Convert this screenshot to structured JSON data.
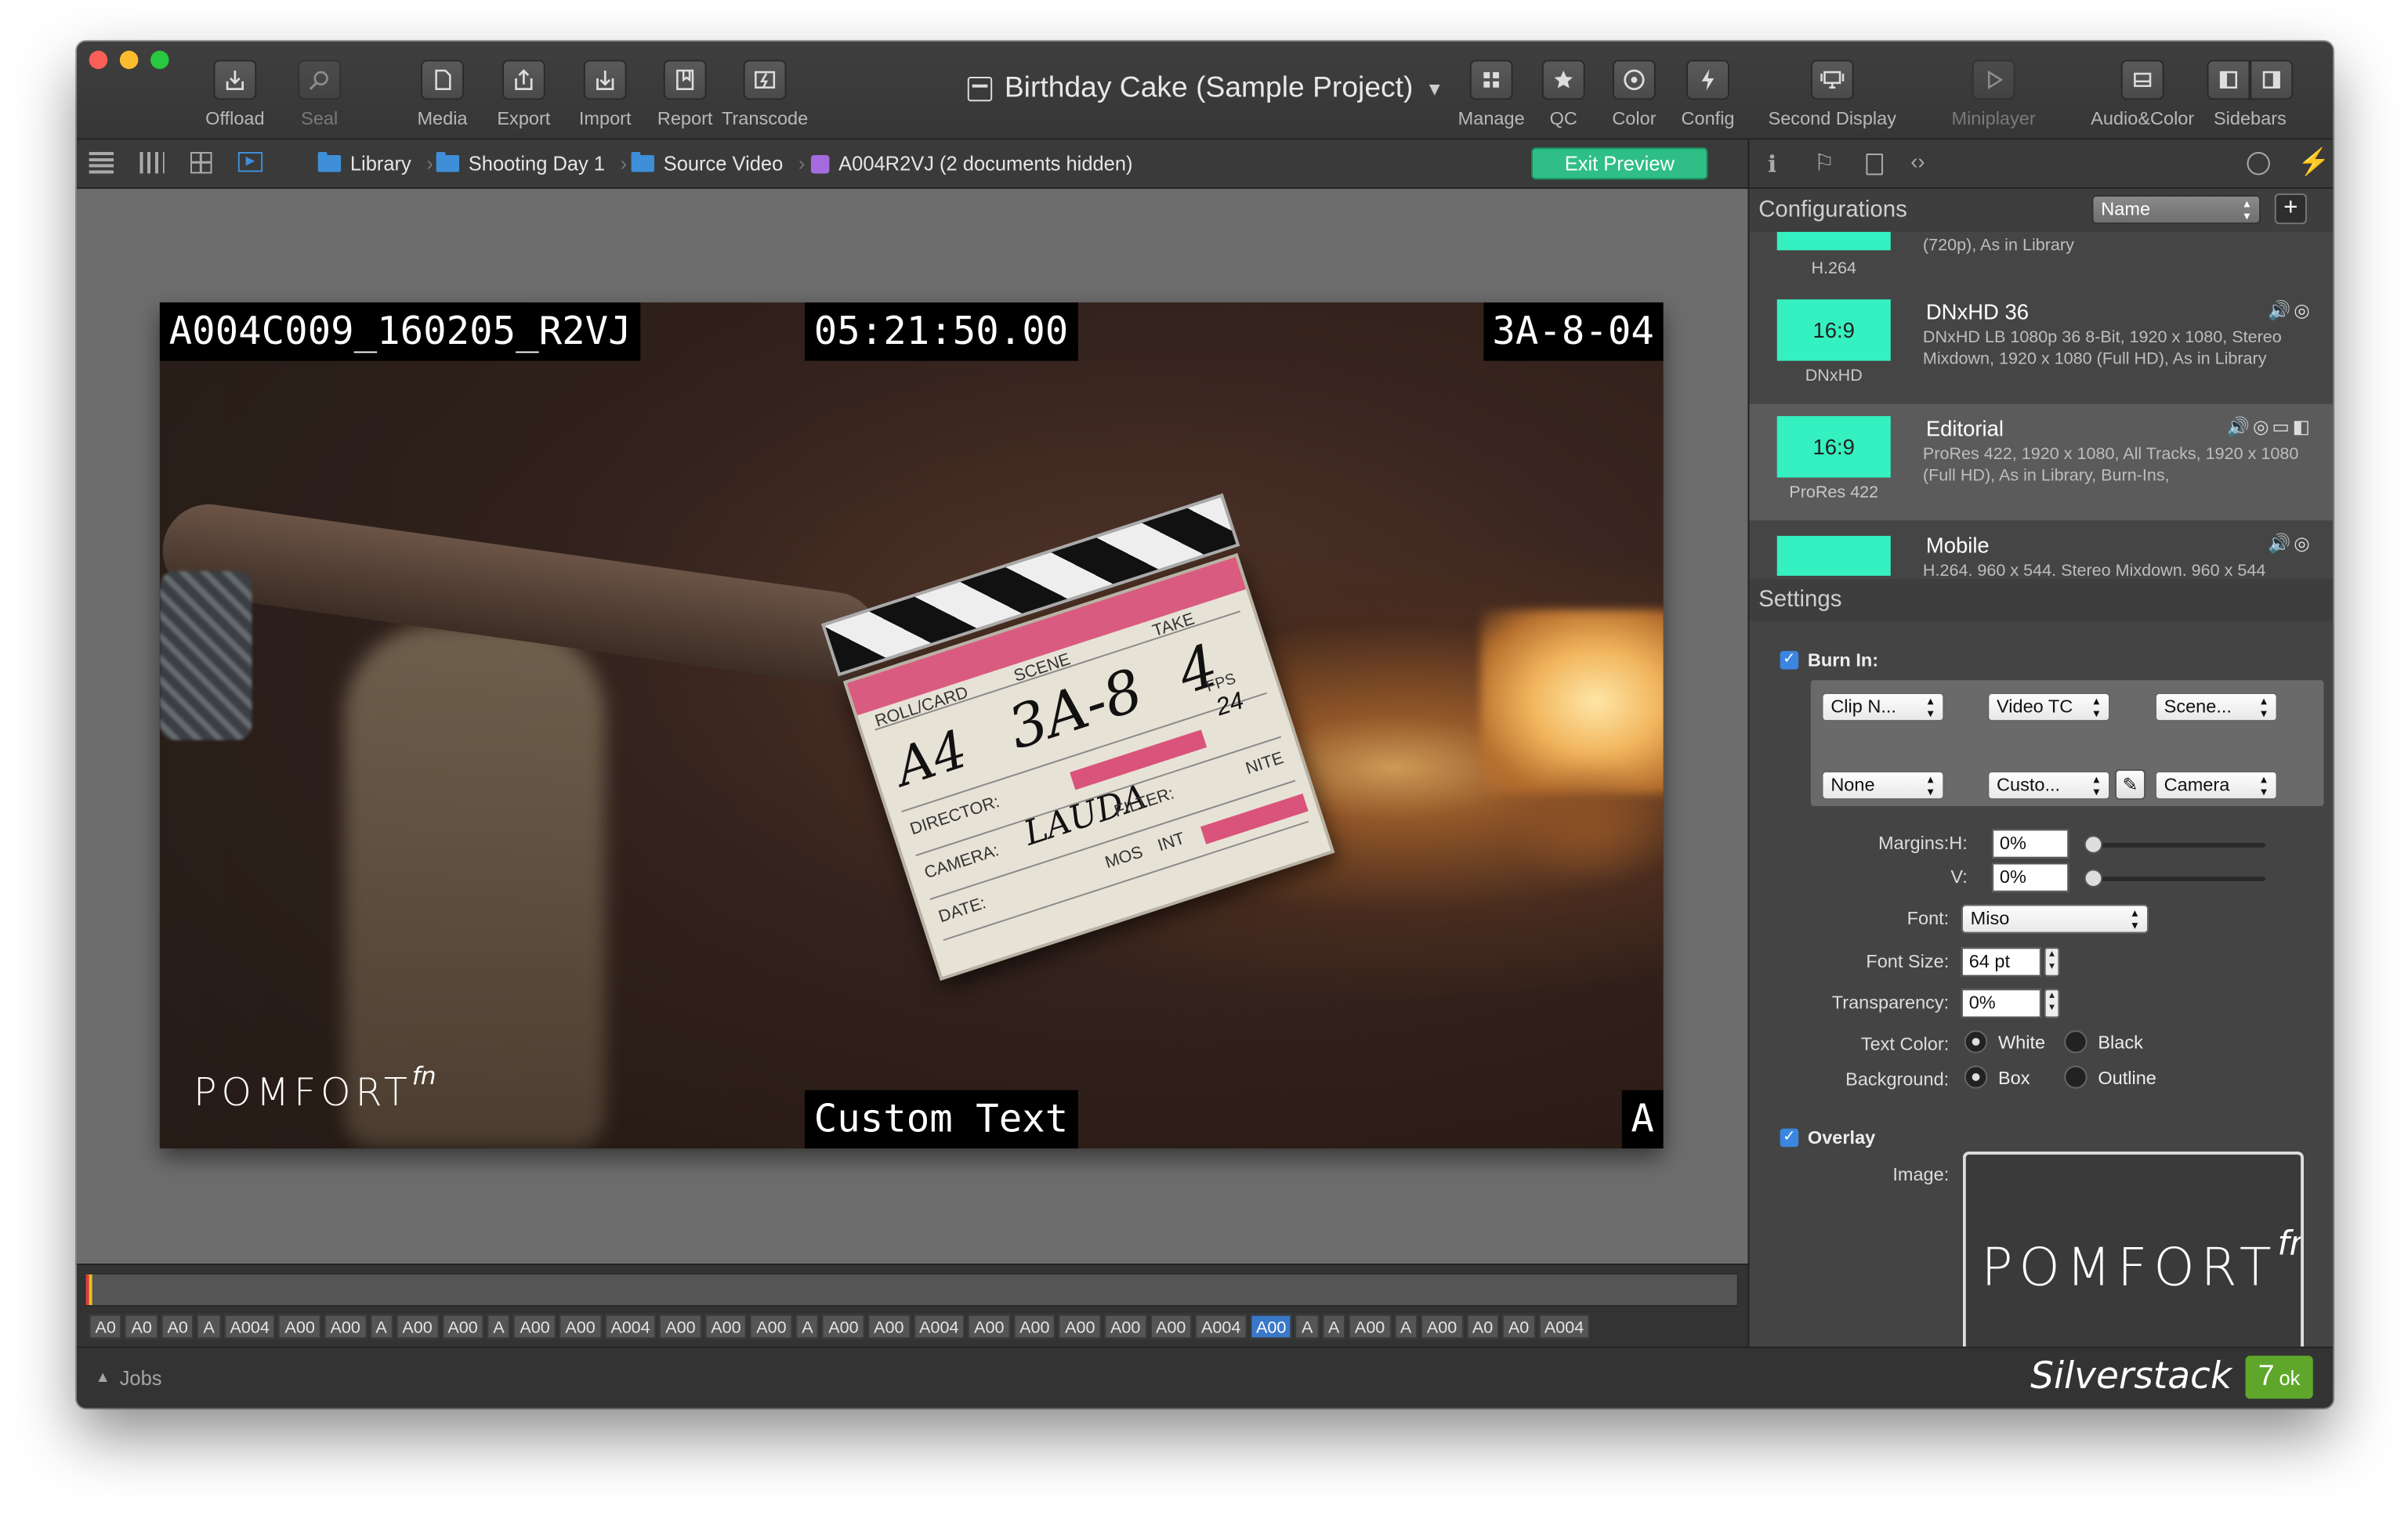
{
  "toolbar": {
    "items": [
      {
        "label": "Offload",
        "icon": "offload-icon"
      },
      {
        "label": "Seal",
        "icon": "seal-icon"
      },
      {
        "label": "Media",
        "icon": "media-icon"
      },
      {
        "label": "Export",
        "icon": "export-icon"
      },
      {
        "label": "Import",
        "icon": "import-icon"
      },
      {
        "label": "Report",
        "icon": "report-icon"
      },
      {
        "label": "Transcode",
        "icon": "transcode-icon"
      },
      {
        "label": "Manage",
        "icon": "manage-icon"
      },
      {
        "label": "QC",
        "icon": "star-icon"
      },
      {
        "label": "Color",
        "icon": "color-icon"
      },
      {
        "label": "Config",
        "icon": "lightning-icon"
      },
      {
        "label": "Second Display",
        "icon": "second-display-icon"
      },
      {
        "label": "Miniplayer",
        "icon": "play-icon"
      },
      {
        "label": "Audio&Color",
        "icon": "audio-color-icon"
      },
      {
        "label": "Sidebars",
        "icon": "sidebars-icon"
      }
    ]
  },
  "project_title": "Birthday Cake (Sample Project)",
  "breadcrumb": {
    "items": [
      "Library",
      "Shooting Day 1",
      "Source Video",
      "A004R2VJ (2 documents hidden)"
    ]
  },
  "exit_preview_label": "Exit Preview",
  "burnins": {
    "clip_name": "A004C009_160205_R2VJ",
    "timecode": "05:21:50.00",
    "scene": "3A-8-04",
    "custom": "Custom Text",
    "camera": "A",
    "logo": "POMFORT",
    "logo_sup": "fn"
  },
  "slate_text": {
    "roll": "ROLL/CARD",
    "scene": "SCENE",
    "take": "TAKE",
    "roll_val": "A4",
    "scene_val": "3A-8",
    "take_val": "4",
    "director": "DIRECTOR:",
    "camera": "CAMERA:",
    "camera_val": "LAUDA",
    "date": "DATE:",
    "filter": "FILTER:",
    "fps": "FPS",
    "fps_val": "24",
    "mos": "MOS",
    "int": "INT",
    "nite": "NITE"
  },
  "timeline": {
    "clips": [
      "A0",
      "A0",
      "A0",
      "A",
      "A004",
      "A00",
      "A00",
      "A",
      "A00",
      "A00",
      "A",
      "A00",
      "A00",
      "A004",
      "A00",
      "A00",
      "A00",
      "A",
      "A00",
      "A00",
      "A004",
      "A00",
      "A00",
      "A00",
      "A00",
      "A00",
      "A004",
      "A00",
      "A",
      "A",
      "A00",
      "A",
      "A00",
      "A0",
      "A0",
      "A004"
    ],
    "selected_index": 27
  },
  "status": {
    "jobs": "Jobs",
    "brand": "Silverstack",
    "count": "7",
    "ok": "ok"
  },
  "sidebar": {
    "configurations_title": "Configurations",
    "sort_label": "Name",
    "configs": [
      {
        "codec": "H.264",
        "name": "",
        "desc": "(720p), As in Library",
        "thumb": "",
        "icons": ""
      },
      {
        "codec": "DNxHD",
        "name": "DNxHD 36",
        "desc": "DNxHD LB 1080p 36 8-Bit, 1920 x 1080, Stereo Mixdown, 1920 x 1080 (Full HD), As in Library",
        "thumb": "16:9",
        "icons": "🔊◎"
      },
      {
        "codec": "ProRes 422",
        "name": "Editorial",
        "desc": "ProRes 422, 1920 x 1080, All Tracks, 1920 x 1080 (Full HD), As in Library, Burn-Ins,",
        "thumb": "16:9",
        "icons": "🔊◎▭◧"
      },
      {
        "codec": "",
        "name": "Mobile",
        "desc": "H.264, 960 x 544, Stereo Mixdown, 960 x 544",
        "thumb": "",
        "icons": "🔊◎"
      }
    ],
    "settings_title": "Settings",
    "burn_in_label": "Burn In:",
    "burn_selects": [
      "Clip N...",
      "Video TC",
      "Scene...",
      "None",
      "Custo...",
      "Camera"
    ],
    "margins_label": "Margins:",
    "h_label": "H:",
    "v_label": "V:",
    "margin_h": "0%",
    "margin_v": "0%",
    "font_label": "Font:",
    "font_value": "Miso",
    "font_size_label": "Font Size:",
    "font_size_value": "64 pt",
    "transparency_label": "Transparency:",
    "transparency_value": "0%",
    "text_color_label": "Text Color:",
    "white_label": "White",
    "black_label": "Black",
    "background_label": "Background:",
    "box_label": "Box",
    "outline_label": "Outline",
    "overlay_label": "Overlay",
    "image_label": "Image:",
    "overlay_logo": "POMFORT",
    "overlay_logo_sup": "fn"
  }
}
